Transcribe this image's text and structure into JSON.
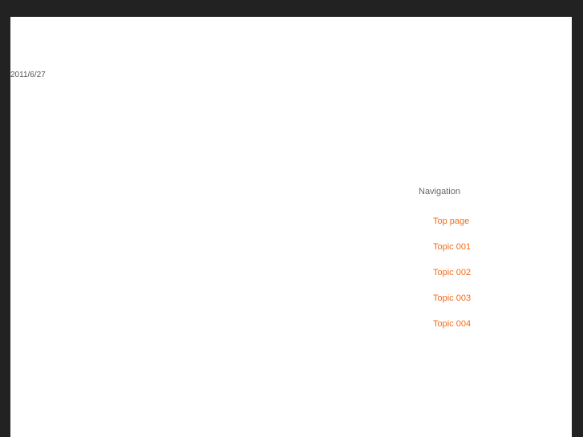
{
  "post": {
    "date": "2011/6/27"
  },
  "navigation": {
    "title": "Navigation",
    "links": [
      {
        "label": "Top page"
      },
      {
        "label": "Topic 001"
      },
      {
        "label": "Topic 002"
      },
      {
        "label": "Topic 003"
      },
      {
        "label": "Topic 004"
      }
    ]
  },
  "colors": {
    "background": "#222222",
    "page": "#ffffff",
    "link": "#f26c1a"
  }
}
